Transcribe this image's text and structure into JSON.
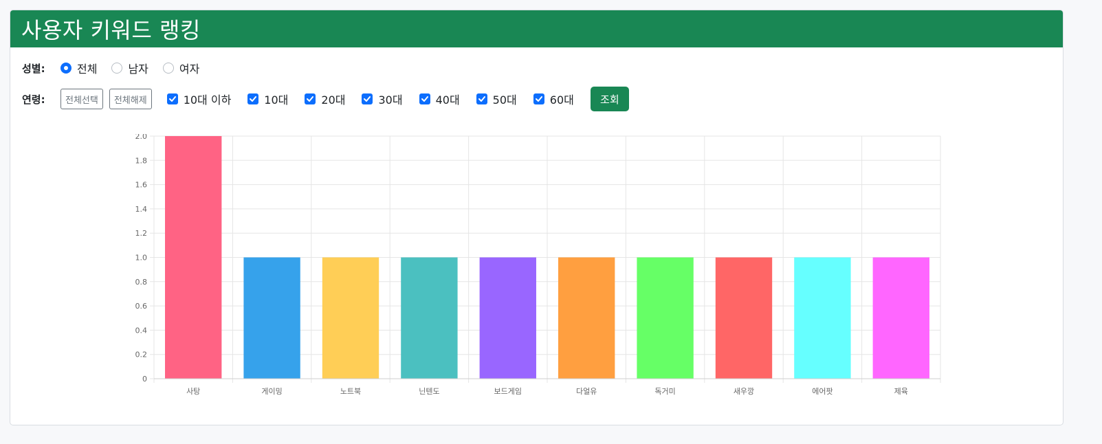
{
  "header": {
    "title": "사용자 키워드 랭킹"
  },
  "gender": {
    "label": "성별:",
    "options": [
      {
        "label": "전체",
        "checked": true
      },
      {
        "label": "남자",
        "checked": false
      },
      {
        "label": "여자",
        "checked": false
      }
    ]
  },
  "age": {
    "label": "연령:",
    "select_all_label": "전체선택",
    "deselect_all_label": "전체해제",
    "options": [
      {
        "label": "10대 이하",
        "checked": true
      },
      {
        "label": "10대",
        "checked": true
      },
      {
        "label": "20대",
        "checked": true
      },
      {
        "label": "30대",
        "checked": true
      },
      {
        "label": "40대",
        "checked": true
      },
      {
        "label": "50대",
        "checked": true
      },
      {
        "label": "60대",
        "checked": true
      }
    ],
    "query_label": "조회"
  },
  "colors": {
    "primary_green": "#198754",
    "checkbox_blue": "#0d6efd"
  },
  "chart_data": {
    "type": "bar",
    "categories": [
      "사탕",
      "게이밍",
      "노트북",
      "닌텐도",
      "보드게임",
      "다얼유",
      "독거미",
      "새우깡",
      "에어팟",
      "제육"
    ],
    "values": [
      2,
      1,
      1,
      1,
      1,
      1,
      1,
      1,
      1,
      1
    ],
    "colors": [
      "#ff6384",
      "#36a2eb",
      "#ffce56",
      "#4bc0c0",
      "#9966ff",
      "#ff9f40",
      "#66ff66",
      "#ff6666",
      "#66ffff",
      "#ff66ff"
    ],
    "ylim": [
      0,
      2
    ],
    "yticks": [
      "0",
      "0.2",
      "0.4",
      "0.6",
      "0.8",
      "1.0",
      "1.2",
      "1.4",
      "1.6",
      "1.8",
      "2.0"
    ],
    "grid": true,
    "legend": false
  }
}
